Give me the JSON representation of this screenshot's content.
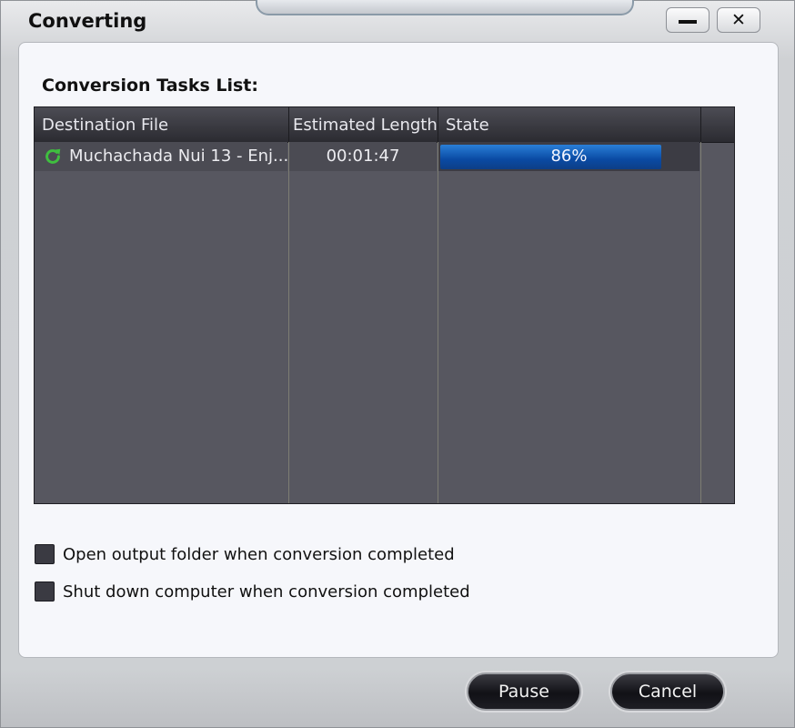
{
  "window": {
    "title": "Converting"
  },
  "titlebar": {
    "minimize_icon": "minimize-icon",
    "close_icon": "close-icon",
    "close_glyph": "✕"
  },
  "tasks": {
    "label": "Conversion Tasks List:",
    "columns": [
      "Destination File",
      "Estimated Length",
      "State"
    ],
    "rows": [
      {
        "file": "Muchachada Nui 13 - Enj...",
        "length": "00:01:47",
        "state_text": "86%",
        "progress": 0.86,
        "icon": "sync-icon"
      }
    ]
  },
  "options": {
    "open_folder": {
      "label": "Open output folder when conversion completed",
      "checked": false
    },
    "shutdown": {
      "label": "Shut down computer when conversion completed",
      "checked": false
    }
  },
  "buttons": {
    "pause": "Pause",
    "cancel": "Cancel"
  },
  "colors": {
    "progress": "#0a4aa3",
    "sync_icon": "#3fbf3f"
  }
}
